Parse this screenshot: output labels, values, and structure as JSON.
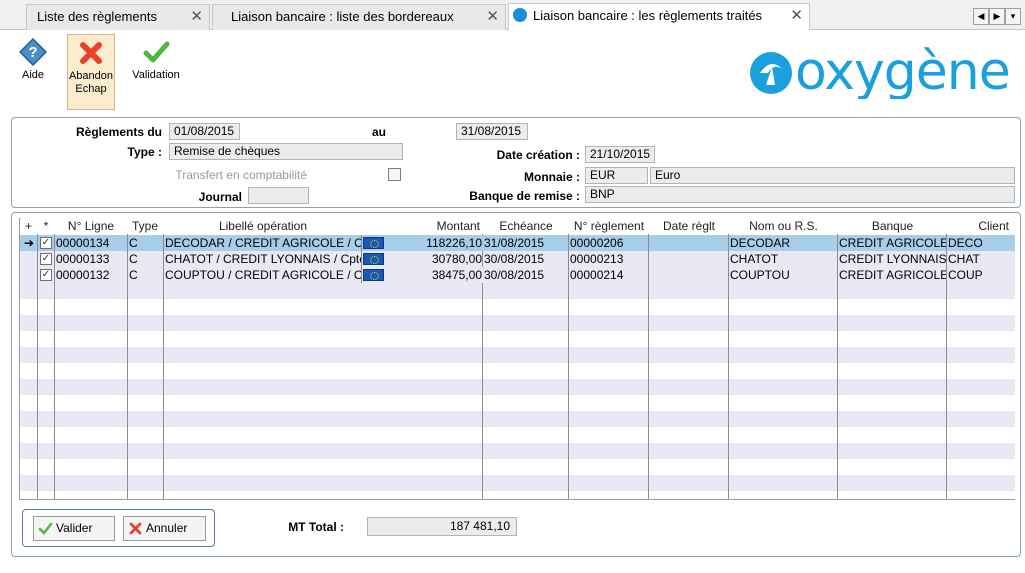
{
  "tabs": [
    {
      "label": "Liste des règlements"
    },
    {
      "label": "Liaison bancaire : liste des bordereaux"
    },
    {
      "label": "Liaison bancaire : les règlements traités"
    }
  ],
  "toolbar": {
    "help": "Aide",
    "abandon_line1": "Abandon",
    "abandon_line2": "Echap",
    "validation": "Validation"
  },
  "logo_text": "oxygène",
  "form": {
    "reglements_du_label": "Règlements du",
    "date_from": "01/08/2015",
    "au_label": "au",
    "date_to": "31/08/2015",
    "type_label": "Type :",
    "type_value": "Remise de chèques",
    "date_creation_label": "Date création :",
    "date_creation_value": "21/10/2015",
    "transfert_label": "Transfert en comptabilité",
    "monnaie_label": "Monnaie :",
    "monnaie_code": "EUR",
    "monnaie_name": "Euro",
    "journal_label": "Journal",
    "journal_value": "",
    "banque_label": "Banque de remise :",
    "banque_value": "BNP"
  },
  "grid": {
    "columns": {
      "add": "+",
      "star": "*",
      "ligne": "N° Ligne",
      "type": "Type",
      "libelle": "Libellé opération",
      "montant": "Montant",
      "echeance": "Echéance",
      "reglement": "N° règlement",
      "date_reglt": "Date règlt",
      "nom": "Nom ou R.S.",
      "banque": "Banque",
      "client": "Client"
    },
    "rows": [
      {
        "ligne": "00000134",
        "type": "C",
        "libelle": "DECODAR / CREDIT AGRICOLE / Cp",
        "montant": "118226,10",
        "echeance": "31/08/2015",
        "reglement": "00000206",
        "date_reglt": "",
        "nom": "DECODAR",
        "banque": "CREDIT AGRICOLE",
        "client": "DECO"
      },
      {
        "ligne": "00000133",
        "type": "C",
        "libelle": "CHATOT / CREDIT LYONNAIS / Cpte",
        "montant": "30780,00",
        "echeance": "30/08/2015",
        "reglement": "00000213",
        "date_reglt": "",
        "nom": "CHATOT",
        "banque": "CREDIT LYONNAIS",
        "client": "CHAT"
      },
      {
        "ligne": "00000132",
        "type": "C",
        "libelle": "COUPTOU / CREDIT AGRICOLE / Cp",
        "montant": "38475,00",
        "echeance": "30/08/2015",
        "reglement": "00000214",
        "date_reglt": "",
        "nom": "COUPTOU",
        "banque": "CREDIT AGRICOLE",
        "client": "COUP"
      }
    ],
    "row_marker": "➔",
    "checkmark": "✓"
  },
  "bottom": {
    "valider": "Valider",
    "annuler": "Annuler",
    "mt_total_label": "MT Total :",
    "mt_total_value": "187 481,10"
  }
}
